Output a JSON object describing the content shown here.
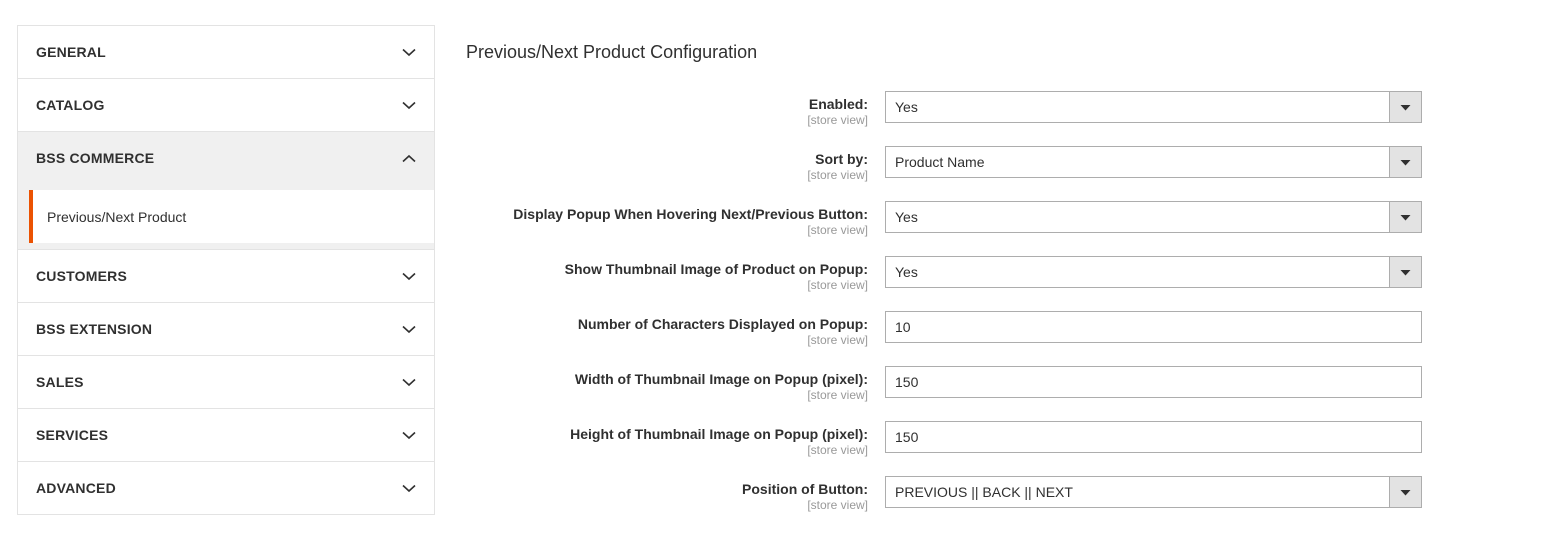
{
  "sidebar": {
    "sections": [
      {
        "label": "GENERAL",
        "icon": "chevron-down-icon",
        "expanded": false
      },
      {
        "label": "CATALOG",
        "icon": "chevron-down-icon",
        "expanded": false
      },
      {
        "label": "BSS COMMERCE",
        "icon": "chevron-up-icon",
        "expanded": true,
        "items": [
          {
            "label": "Previous/Next Product",
            "current": true
          }
        ]
      },
      {
        "label": "CUSTOMERS",
        "icon": "chevron-down-icon",
        "expanded": false
      },
      {
        "label": "BSS EXTENSION",
        "icon": "chevron-down-icon",
        "expanded": false
      },
      {
        "label": "SALES",
        "icon": "chevron-down-icon",
        "expanded": false
      },
      {
        "label": "SERVICES",
        "icon": "chevron-down-icon",
        "expanded": false
      },
      {
        "label": "ADVANCED",
        "icon": "chevron-down-icon",
        "expanded": false
      }
    ]
  },
  "main": {
    "heading": "Previous/Next Product Configuration",
    "scope_label": "[store view]",
    "fields": [
      {
        "label": "Enabled:",
        "scope": "[store view]",
        "type": "select",
        "value": "Yes"
      },
      {
        "label": "Sort by:",
        "scope": "[store view]",
        "type": "select",
        "value": "Product Name"
      },
      {
        "label": "Display Popup When Hovering Next/Previous Button:",
        "scope": "[store view]",
        "type": "select",
        "value": "Yes"
      },
      {
        "label": "Show Thumbnail Image of Product on Popup:",
        "scope": "[store view]",
        "type": "select",
        "value": "Yes"
      },
      {
        "label": "Number of Characters Displayed on Popup:",
        "scope": "[store view]",
        "type": "text",
        "value": "10"
      },
      {
        "label": "Width of Thumbnail Image on Popup (pixel):",
        "scope": "[store view]",
        "type": "text",
        "value": "150"
      },
      {
        "label": "Height of Thumbnail Image on Popup (pixel):",
        "scope": "[store view]",
        "type": "text",
        "value": "150"
      },
      {
        "label": "Position of Button:",
        "scope": "[store view]",
        "type": "select",
        "value": "PREVIOUS || BACK || NEXT"
      }
    ]
  },
  "colors": {
    "accent": "#eb5202",
    "text": "#303030",
    "muted": "#999999",
    "border": "#e3e3e3",
    "field_border": "#adadad",
    "panel_active": "#f0f0f0"
  }
}
